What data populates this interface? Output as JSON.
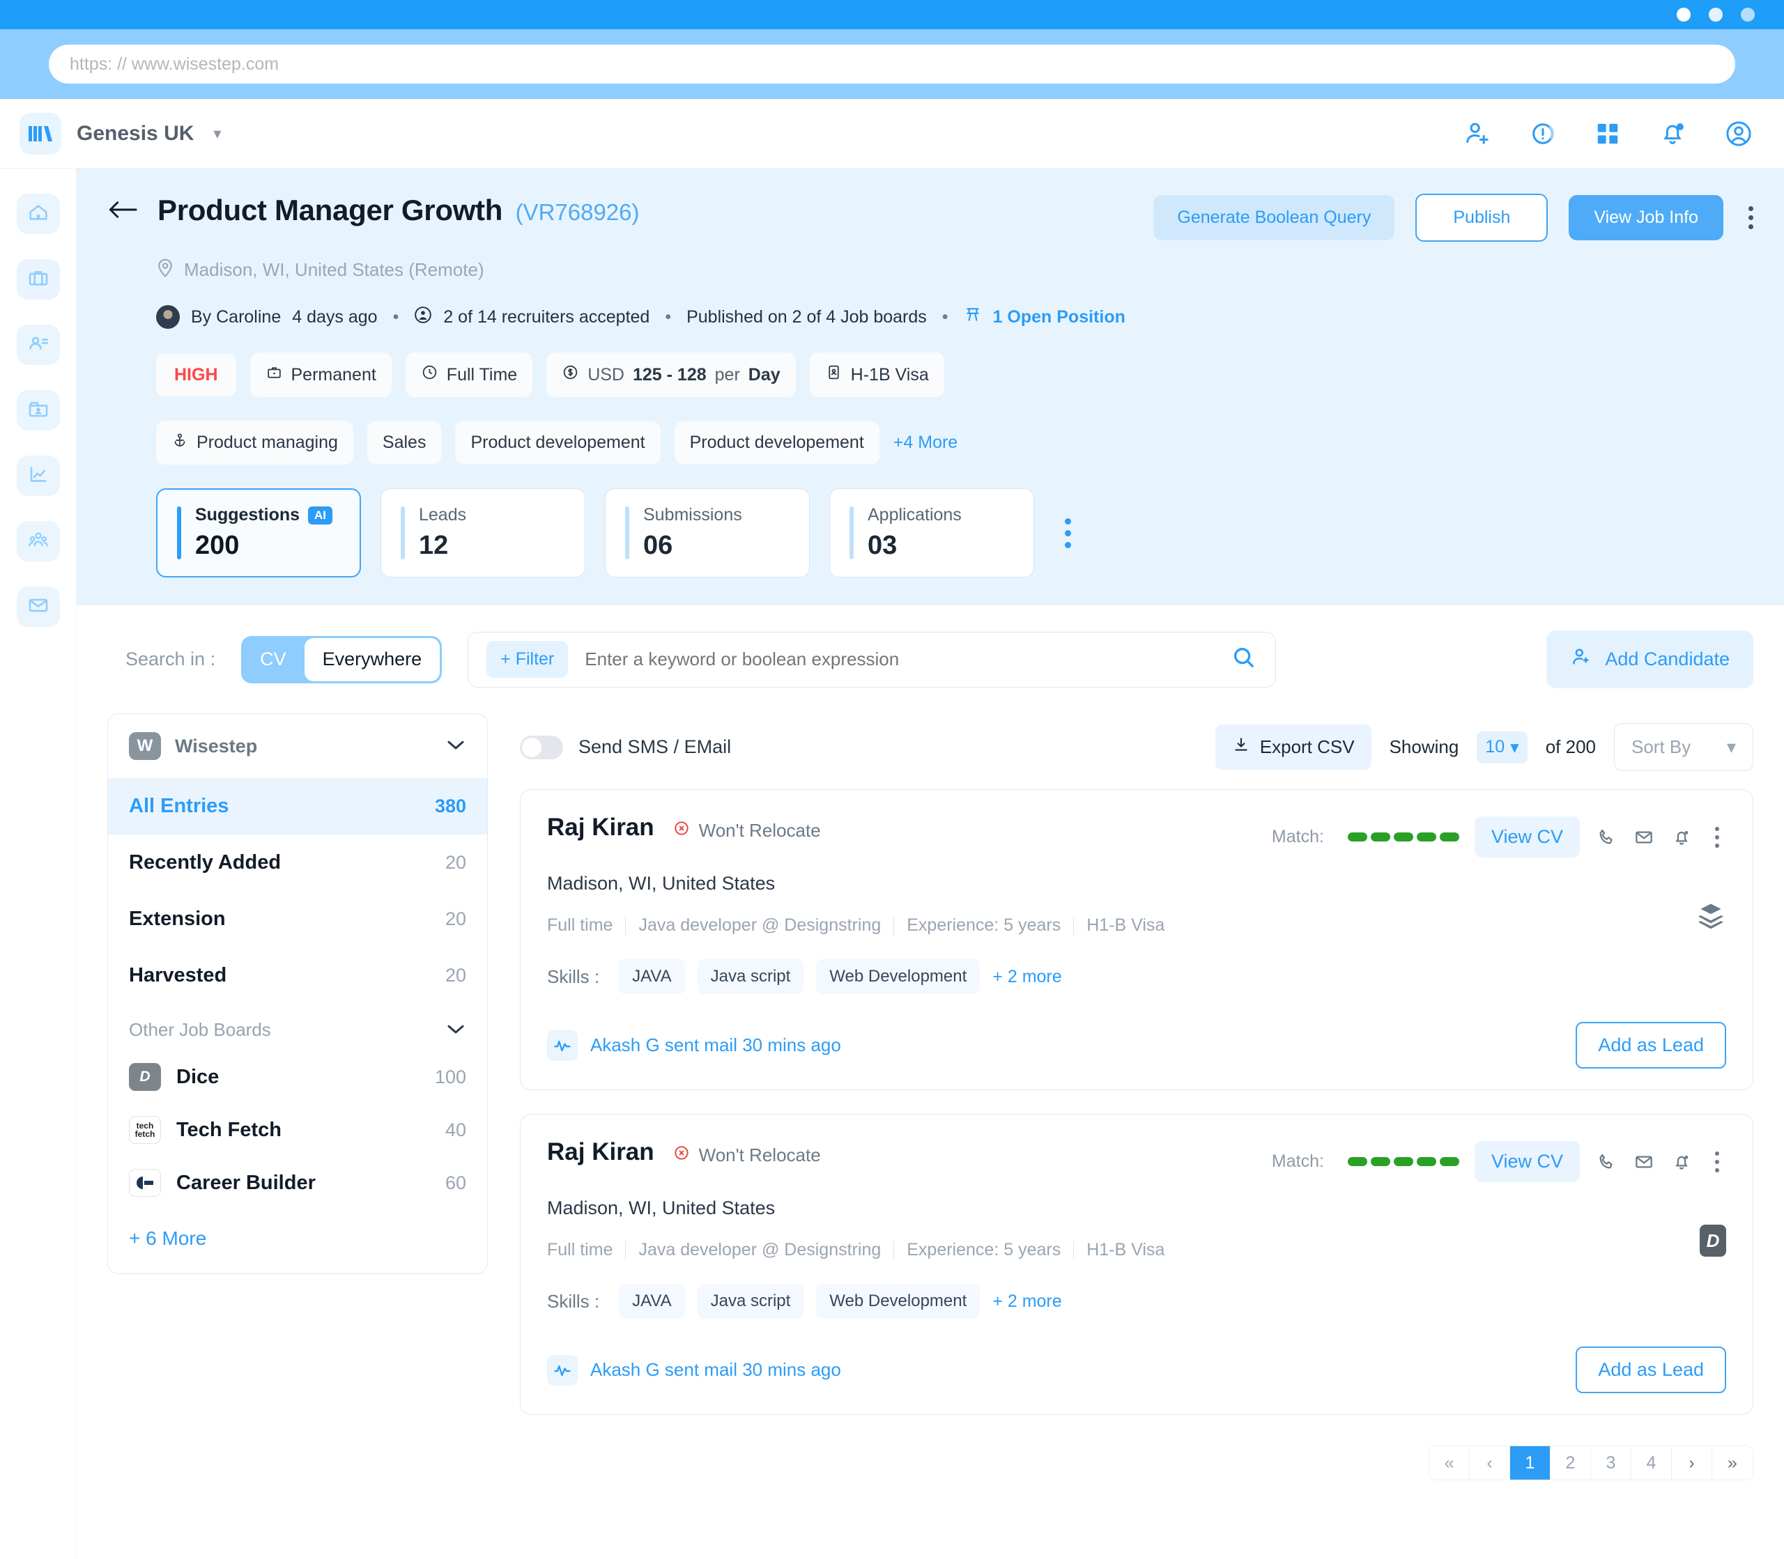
{
  "browser": {
    "url_placeholder": "https: // www.wisestep.com"
  },
  "header": {
    "org_name": "Genesis UK",
    "logo_text": "ws",
    "icons": [
      "add-user-icon",
      "alert-circle-icon",
      "apps-grid-icon",
      "notification-bell-icon",
      "account-avatar-icon"
    ]
  },
  "nav_rail": {
    "items": [
      {
        "name": "home",
        "icon": "home-icon",
        "active": false
      },
      {
        "name": "jobs",
        "icon": "briefcase-icon",
        "active": true
      },
      {
        "name": "candidates",
        "icon": "user-list-icon",
        "active": false
      },
      {
        "name": "contacts",
        "icon": "id-card-icon",
        "active": false
      },
      {
        "name": "analytics",
        "icon": "chart-line-icon",
        "active": false
      },
      {
        "name": "teams",
        "icon": "people-group-icon",
        "active": false
      },
      {
        "name": "mail",
        "icon": "envelope-icon",
        "active": false
      }
    ]
  },
  "job": {
    "title": "Product Manager Growth",
    "code": "(VR768926)",
    "location": "Madison, WI, United States (Remote)",
    "meta": {
      "author": "By Caroline",
      "posted": "4 days ago",
      "recruiters": "2 of 14 recruiters accepted",
      "published": "Published on 2 of 4 Job boards",
      "open_position": "1 Open Position"
    },
    "actions": {
      "generate_boolean": "Generate Boolean Query",
      "publish": "Publish",
      "view_job_info": "View Job Info"
    },
    "attributes": [
      {
        "label": "HIGH",
        "kind": "priority"
      },
      {
        "label": "Permanent",
        "icon": "briefcase-icon"
      },
      {
        "label": "Full Time",
        "icon": "clock-icon"
      },
      {
        "label": "USD 125 - 128 per Day",
        "icon": "dollar-icon",
        "prefix": "USD",
        "amount": "125 - 128",
        "suffix_label": "per",
        "suffix_bold": "Day"
      },
      {
        "label": "H-1B Visa",
        "icon": "id-card-icon"
      }
    ],
    "tags": [
      "Product managing",
      "Sales",
      "Product developement",
      "Product developement"
    ],
    "tags_more": "+4 More",
    "stats": [
      {
        "label": "Suggestions",
        "value": "200",
        "badge": "AI",
        "active": true
      },
      {
        "label": "Leads",
        "value": "12",
        "active": false
      },
      {
        "label": "Submissions",
        "value": "06",
        "active": false
      },
      {
        "label": "Applications",
        "value": "03",
        "active": false
      }
    ]
  },
  "search": {
    "search_in_label": "Search in :",
    "segments": [
      {
        "label": "CV",
        "active": false
      },
      {
        "label": "Everywhere",
        "active": true
      }
    ],
    "filter_label": "+ Filter",
    "placeholder": "Enter a keyword or boolean expression",
    "value": "",
    "add_candidate": "Add Candidate"
  },
  "facets": {
    "source_title": "Wisestep",
    "source_logo": "W",
    "items": [
      {
        "label": "All Entries",
        "count": "380",
        "selected": true
      },
      {
        "label": "Recently Added",
        "count": "20",
        "selected": false
      },
      {
        "label": "Extension",
        "count": "20",
        "selected": false
      },
      {
        "label": "Harvested",
        "count": "20",
        "selected": false
      }
    ],
    "other_boards_label": "Other Job Boards",
    "boards": [
      {
        "label": "Dice",
        "count": "100",
        "icon": "dice-logo"
      },
      {
        "label": "Tech Fetch",
        "count": "40",
        "icon": "techfetch-logo"
      },
      {
        "label": "Career Builder",
        "count": "60",
        "icon": "careerbuilder-logo"
      }
    ],
    "more_label": "+ 6 More"
  },
  "results_toolbar": {
    "sms_toggle_label": "Send SMS / EMail",
    "sms_toggle_on": false,
    "export_label": "Export CSV",
    "showing_label": "Showing",
    "showing_count": "10",
    "of_label": "of 200",
    "sort_by_placeholder": "Sort By"
  },
  "candidates": [
    {
      "name": "Raj Kiran",
      "relocate": "Won't Relocate",
      "location": "Madison, WI, United States",
      "details": [
        "Full time",
        "Java developer @ Designstring",
        "Experience: 5 years",
        "H1-B Visa"
      ],
      "match_label": "Match:",
      "match_score": 5,
      "view_cv": "View CV",
      "skills_label": "Skills :",
      "skills": [
        "JAVA",
        "Java script",
        "Web Development"
      ],
      "skills_more": "+ 2 more",
      "activity": "Akash G sent mail 30 mins ago",
      "add_as_lead": "Add as Lead",
      "badge": "layers-icon"
    },
    {
      "name": "Raj Kiran",
      "relocate": "Won't Relocate",
      "location": "Madison, WI, United States",
      "details": [
        "Full time",
        "Java developer @ Designstring",
        "Experience: 5 years",
        "H1-B Visa"
      ],
      "match_label": "Match:",
      "match_score": 5,
      "view_cv": "View CV",
      "skills_label": "Skills :",
      "skills": [
        "JAVA",
        "Java script",
        "Web Development"
      ],
      "skills_more": "+ 2 more",
      "activity": "Akash G sent mail 30 mins ago",
      "add_as_lead": "Add as Lead",
      "badge": "dice-logo"
    }
  ],
  "pagination": {
    "first": "«",
    "prev": "‹",
    "next": "›",
    "last": "»",
    "pages": [
      "1",
      "2",
      "3",
      "4"
    ],
    "current": "1"
  },
  "colors": {
    "accent": "#2c9cf6",
    "panel_bg": "#e8f4fd",
    "match_green": "#2aa028",
    "priority_red": "#ff4545"
  }
}
